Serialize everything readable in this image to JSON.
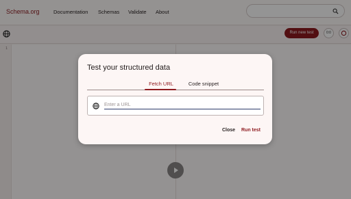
{
  "header": {
    "brand": "Schema.org",
    "nav": [
      "Documentation",
      "Schemas",
      "Validate",
      "About"
    ],
    "search": {
      "placeholder": "",
      "icon": "search-icon"
    }
  },
  "toolbar": {
    "run_new_test": "Run new test",
    "badge": "0:0",
    "icons": [
      "globe-icon",
      "settings-icon"
    ]
  },
  "editor": {
    "line_number": "1"
  },
  "dialog": {
    "title": "Test your structured data",
    "tabs": [
      {
        "label": "Fetch URL",
        "active": true
      },
      {
        "label": "Code snippet",
        "active": false
      }
    ],
    "url_field": {
      "placeholder": "Enter a URL",
      "value": ""
    },
    "buttons": {
      "close": "Close",
      "run": "Run test"
    }
  },
  "colors": {
    "accent": "#8e1a1f",
    "scrim": "rgba(0,0,0,0.42)"
  }
}
